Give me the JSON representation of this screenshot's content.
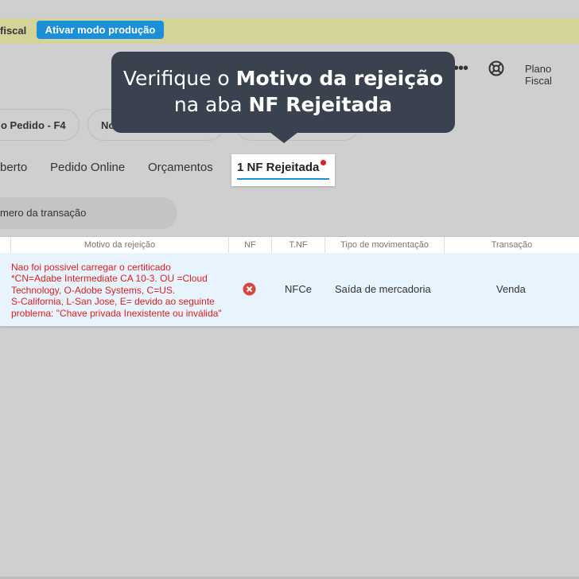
{
  "banner": {
    "text": "fiscal",
    "button_label": "Ativar modo produção",
    "background": "#d4d49a",
    "button_color": "#1b8fd8"
  },
  "header": {
    "more_icon": "more-icon",
    "help_icon": "lifebuoy-icon",
    "plan_label": "Plano Fiscal"
  },
  "tooltip": {
    "line1_prefix": "Verifique o ",
    "line1_bold": "Motivo da rejeição",
    "line2_prefix": "na aba ",
    "line2_bold": "NF Rejeitada"
  },
  "pills": [
    "o Pedido - F4",
    "No",
    ""
  ],
  "tabs": {
    "items": [
      "berto",
      "Pedido Online",
      "Orçamentos"
    ],
    "active_label": "1 NF Rejeitada",
    "accent": "#1b8fd8",
    "alert_color": "#e0202a"
  },
  "search": {
    "placeholder": "mero da transação"
  },
  "table": {
    "headers": [
      "Motivo da rejeição",
      "NF",
      "T.NF",
      "Tipo de movimentação",
      "Transação"
    ],
    "rows": [
      {
        "reason_lines": [
          "Nao foi possivel carregar o certiticado",
          "*CN=Adabe Intermediate CA 10-3. OU =Cloud",
          "Technology, O-Adobe Systems, C=US.",
          "S-California, L-San Jose, E= devido ao seguinte",
          "problema: \"Chave privada Inexistente ou inválida\""
        ],
        "nf_status_icon": "error-x-icon",
        "tnf": "NFCe",
        "movement_type": "Saída de mercadoria",
        "transaction": "Venda"
      }
    ],
    "error_color": "#e01c1c",
    "row_highlight": "#e8f4fd"
  }
}
